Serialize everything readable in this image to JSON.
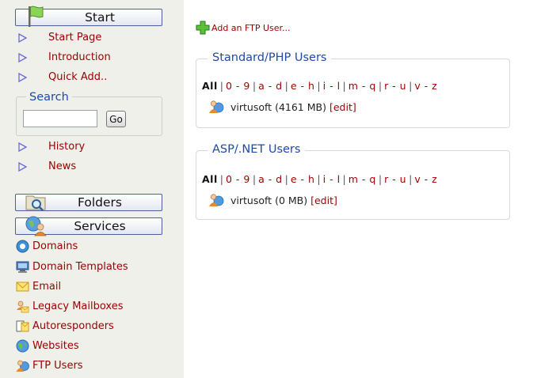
{
  "sidebar": {
    "start_label": "Start",
    "folders_label": "Folders",
    "services_label": "Services",
    "start_items": [
      "Start Page",
      "Introduction",
      "Quick Add.."
    ],
    "search": {
      "legend": "Search",
      "go_label": "Go",
      "value": ""
    },
    "extra_items": [
      "History",
      "News"
    ],
    "services": [
      {
        "label": "Domains",
        "icon": "domains-icon"
      },
      {
        "label": "Domain Templates",
        "icon": "domain-templates-icon"
      },
      {
        "label": "Email",
        "icon": "email-icon"
      },
      {
        "label": "Legacy Mailboxes",
        "icon": "legacy-mailboxes-icon"
      },
      {
        "label": "Autoresponders",
        "icon": "autoresponders-icon"
      },
      {
        "label": "Websites",
        "icon": "websites-icon"
      },
      {
        "label": "FTP Users",
        "icon": "ftp-users-icon"
      }
    ]
  },
  "main": {
    "add_ftp_label": "Add an FTP User...",
    "filter_links": [
      "All",
      "0 - 9",
      "a - d",
      "e - h",
      "i - l",
      "m - q",
      "r - u",
      "v - z"
    ],
    "groups": [
      {
        "title": "Standard/PHP Users",
        "user": "virtusoft",
        "size": "(4161 MB)",
        "edit_label": "[edit]"
      },
      {
        "title": "ASP/.NET Users",
        "user": "virtusoft",
        "size": "(0 MB)",
        "edit_label": "[edit]"
      }
    ]
  },
  "colors": {
    "link": "#990000",
    "legend": "#1f49a8",
    "sidebar_bg": "#f0f0ea",
    "button_border": "#4a5f9e"
  }
}
